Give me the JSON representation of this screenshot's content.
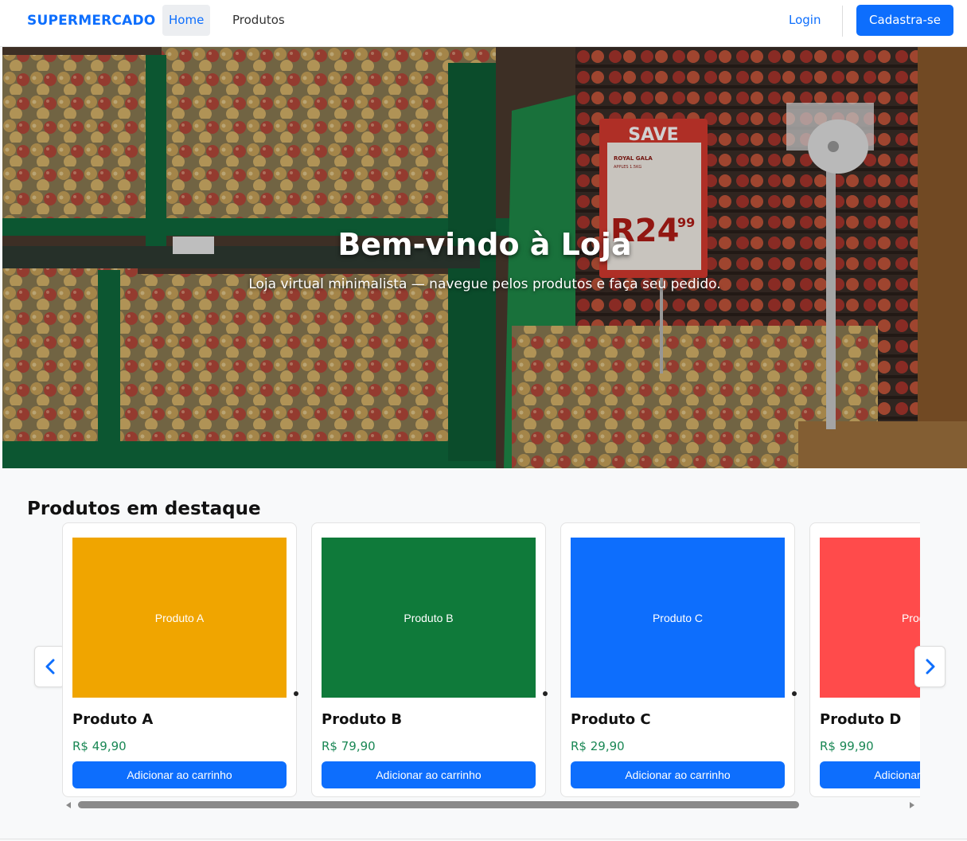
{
  "navbar": {
    "brand": "SUPERMERCADO",
    "links": [
      {
        "label": "Home",
        "active": true
      },
      {
        "label": "Produtos",
        "active": false
      }
    ],
    "login_label": "Login",
    "signup_label": "Cadastra-se"
  },
  "hero": {
    "title": "Bem-vindo à Loja",
    "subtitle": "Loja virtual minimalista — navegue pelos produtos e faça seu pedido.",
    "sign": {
      "heading": "SAVE",
      "product": "ROYAL GALA",
      "detail": "APPLES 1.5KG",
      "price_main": "R24",
      "price_cents": "99"
    }
  },
  "featured": {
    "title": "Produtos em destaque",
    "add_label": "Adicionar ao carrinho",
    "products": [
      {
        "name": "Produto A",
        "image_label": "Produto A",
        "price": "R$ 49,90",
        "color": "#f0a500"
      },
      {
        "name": "Produto B",
        "image_label": "Produto B",
        "price": "R$ 79,90",
        "color": "#0f7a3a"
      },
      {
        "name": "Produto C",
        "image_label": "Produto C",
        "price": "R$ 29,90",
        "color": "#0d6efd"
      },
      {
        "name": "Produto D",
        "image_label": "Produto D",
        "price": "R$ 99,90",
        "color": "#ff4b4b"
      }
    ]
  },
  "icons": {
    "prev": "chevron-left-icon",
    "next": "chevron-right-icon"
  },
  "colors": {
    "primary": "#0d6efd",
    "price": "#198754"
  }
}
